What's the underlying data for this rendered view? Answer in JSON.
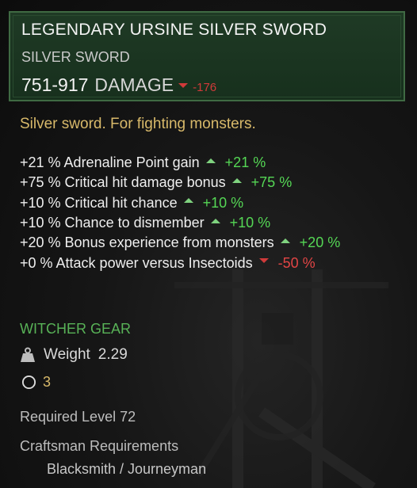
{
  "item": {
    "name": "LEGENDARY URSINE SILVER SWORD",
    "type": "SILVER SWORD",
    "damage_value": "751-917",
    "damage_label": "DAMAGE",
    "damage_diff": "-176",
    "description": "Silver sword. For fighting monsters."
  },
  "stats": [
    {
      "text": "+21 % Adrenaline Point gain",
      "diff": "+21 %",
      "direction": "up"
    },
    {
      "text": "+75 % Critical hit damage bonus",
      "diff": "+75 %",
      "direction": "up"
    },
    {
      "text": "+10 % Critical hit chance",
      "diff": "+10 %",
      "direction": "up"
    },
    {
      "text": "+10 % Chance to dismember",
      "diff": "+10 %",
      "direction": "up"
    },
    {
      "text": "+20 % Bonus experience from monsters",
      "diff": "+20 %",
      "direction": "up"
    },
    {
      "text": "+0 % Attack power versus Insectoids",
      "diff": "-50 %",
      "direction": "down"
    }
  ],
  "gear": {
    "label": "WITCHER GEAR",
    "weight_label": "Weight",
    "weight_value": "2.29",
    "slots_value": "3"
  },
  "requirements": {
    "level": "Required Level 72",
    "craftsman_title": "Craftsman Requirements",
    "craftsman_value": "Blacksmith / Journeyman"
  },
  "colors": {
    "header_bg": "#1f3a25",
    "header_border": "#3f6a43",
    "positive": "#55d755",
    "negative": "#e24545",
    "gold": "#d8b96a",
    "gear_green": "#58b257"
  },
  "icons": {
    "weight": "weight-icon",
    "slots": "slot-ring-icon",
    "up": "triangle-up-icon",
    "down": "triangle-down-icon"
  }
}
